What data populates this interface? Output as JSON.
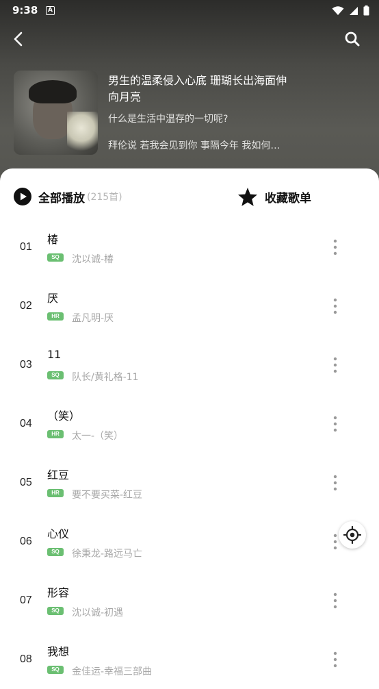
{
  "status_bar": {
    "time": "9:38",
    "indicator": "A",
    "icons": [
      "wifi-icon",
      "signal-icon",
      "battery-icon"
    ]
  },
  "nav": {
    "icons": [
      "back-icon",
      "search-icon"
    ]
  },
  "playlist": {
    "title": "男生的温柔侵入心底 珊瑚长出海面伸向月亮",
    "subtitle": "什么是生活中温存的一切呢?",
    "description": "拜伦说 若我会见到你 事隔今年 我如何…"
  },
  "actions": {
    "play_all_label": "全部播放",
    "song_count": "(215首)",
    "collect_label": "收藏歌单"
  },
  "songs": [
    {
      "num": "01",
      "title": "椿",
      "quality": "SQ",
      "artist": "沈以诚-椿"
    },
    {
      "num": "02",
      "title": "厌",
      "quality": "HR",
      "artist": "孟凡明-厌"
    },
    {
      "num": "03",
      "title": "11",
      "quality": "SQ",
      "artist": "队长/黄礼格-11"
    },
    {
      "num": "04",
      "title": "（笑）",
      "quality": "HR",
      "artist": "太一-（笑）"
    },
    {
      "num": "05",
      "title": "红豆",
      "quality": "HR",
      "artist": "要不要买菜-红豆"
    },
    {
      "num": "06",
      "title": "心仪",
      "quality": "SQ",
      "artist": "徐秉龙-路远马亡"
    },
    {
      "num": "07",
      "title": "形容",
      "quality": "SQ",
      "artist": "沈以诚-初遇"
    },
    {
      "num": "08",
      "title": "我想",
      "quality": "SQ",
      "artist": "金佳运-幸福三部曲"
    }
  ],
  "colors": {
    "badge": "#6bbf72",
    "header_dark": "#2c2c2a"
  }
}
